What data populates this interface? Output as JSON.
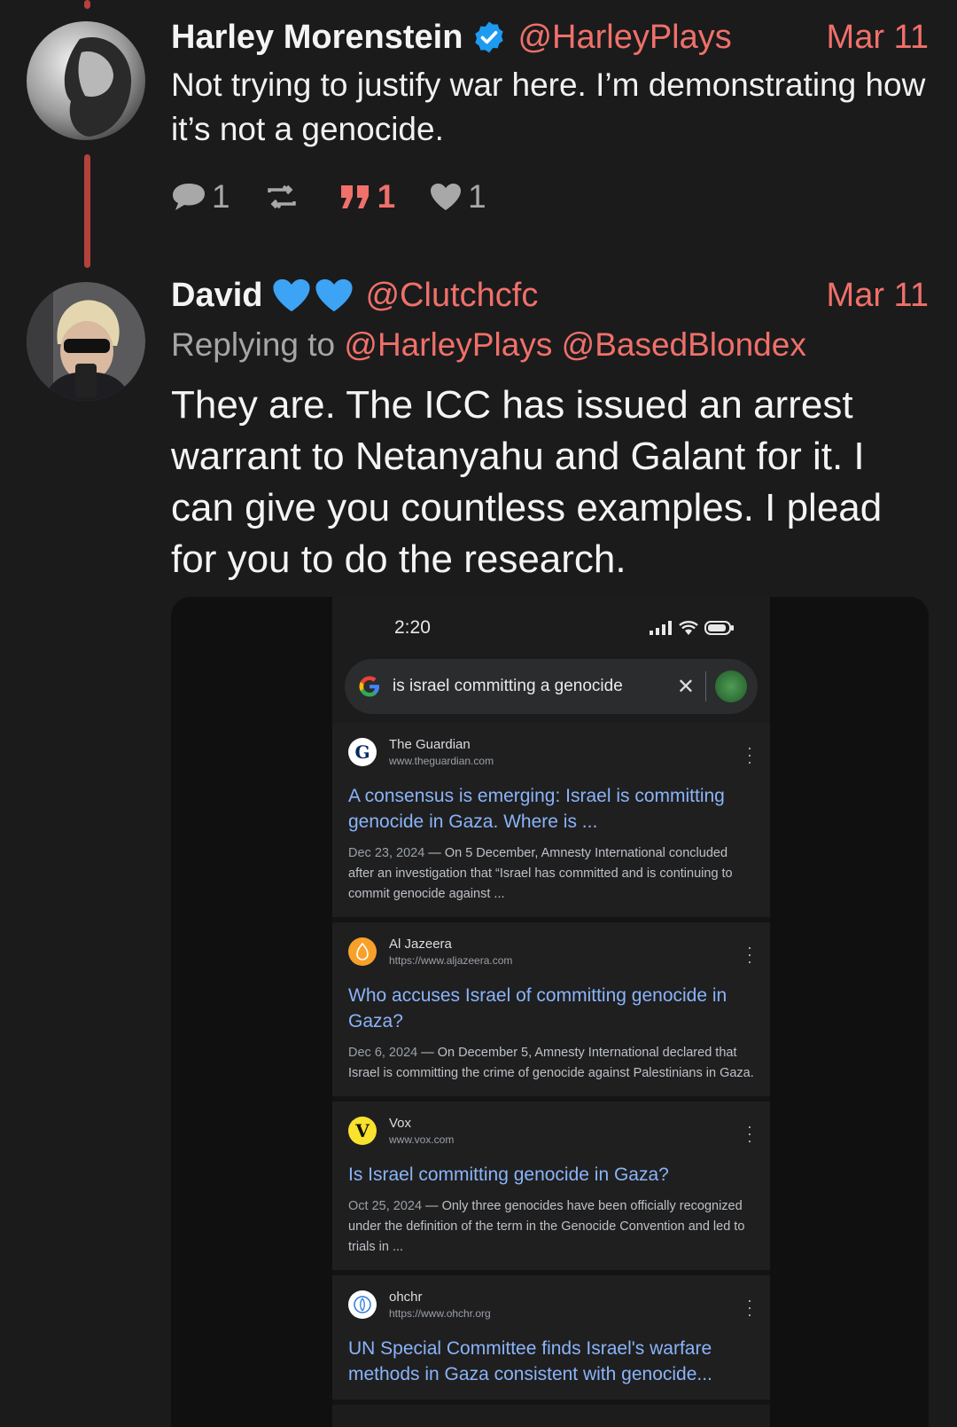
{
  "posts": [
    {
      "name": "Harley Morenstein",
      "handle": "@HarleyPlays",
      "date": "Mar 11",
      "verified_icon": "verified-badge-icon",
      "text": "Not trying to justify war here. I’m demonstrating how it’s not a genocide.",
      "actions": {
        "replies": "1",
        "quotes": "1",
        "likes": "1"
      }
    },
    {
      "name": "David",
      "name_emojis": "💙💙",
      "handle": "@Clutchcfc",
      "date": "Mar 11",
      "replying_to_label": "Replying to",
      "replying_to": [
        "@HarleyPlays",
        "@BasedBlondex"
      ],
      "text": "They are. The ICC has issued an arrest warrant to Netanyahu and Galant for it. I can give you countless examples. I plead for you to do the research."
    }
  ],
  "screenshot": {
    "time": "2:20",
    "query": "is israel committing a genocide",
    "results": [
      {
        "site": "The Guardian",
        "url": "www.theguardian.com",
        "favicon_letter": "G",
        "title": "A consensus is emerging: Israel is committing genocide in Gaza. Where is ...",
        "date": "Dec 23, 2024",
        "snippet": "On 5 December, Amnesty International concluded after an investigation that “Israel has committed and is continuing to commit genocide against ..."
      },
      {
        "site": "Al Jazeera",
        "url": "https://www.aljazeera.com",
        "favicon_letter": "",
        "title": "Who accuses Israel of committing genocide in Gaza?",
        "date": "Dec 6, 2024",
        "snippet": "On December 5, Amnesty International declared that Israel is committing the crime of genocide against Palestinians in Gaza."
      },
      {
        "site": "Vox",
        "url": "www.vox.com",
        "favicon_letter": "V",
        "title": "Is Israel committing genocide in Gaza?",
        "date": "Oct 25, 2024",
        "snippet": "Only three genocides have been officially recognized under the definition of the term in the Genocide Convention and led to trials in ..."
      },
      {
        "site": "ohchr",
        "url": "https://www.ohchr.org",
        "favicon_letter": "",
        "title": "UN Special Committee finds Israel's warfare methods in Gaza consistent with genocide...",
        "date": "",
        "snippet": ""
      }
    ]
  },
  "colors": {
    "accent": "#f0706a",
    "thread_line": "#b5413d",
    "link_blue": "#8ab4f8",
    "background": "#1b1b1c"
  }
}
